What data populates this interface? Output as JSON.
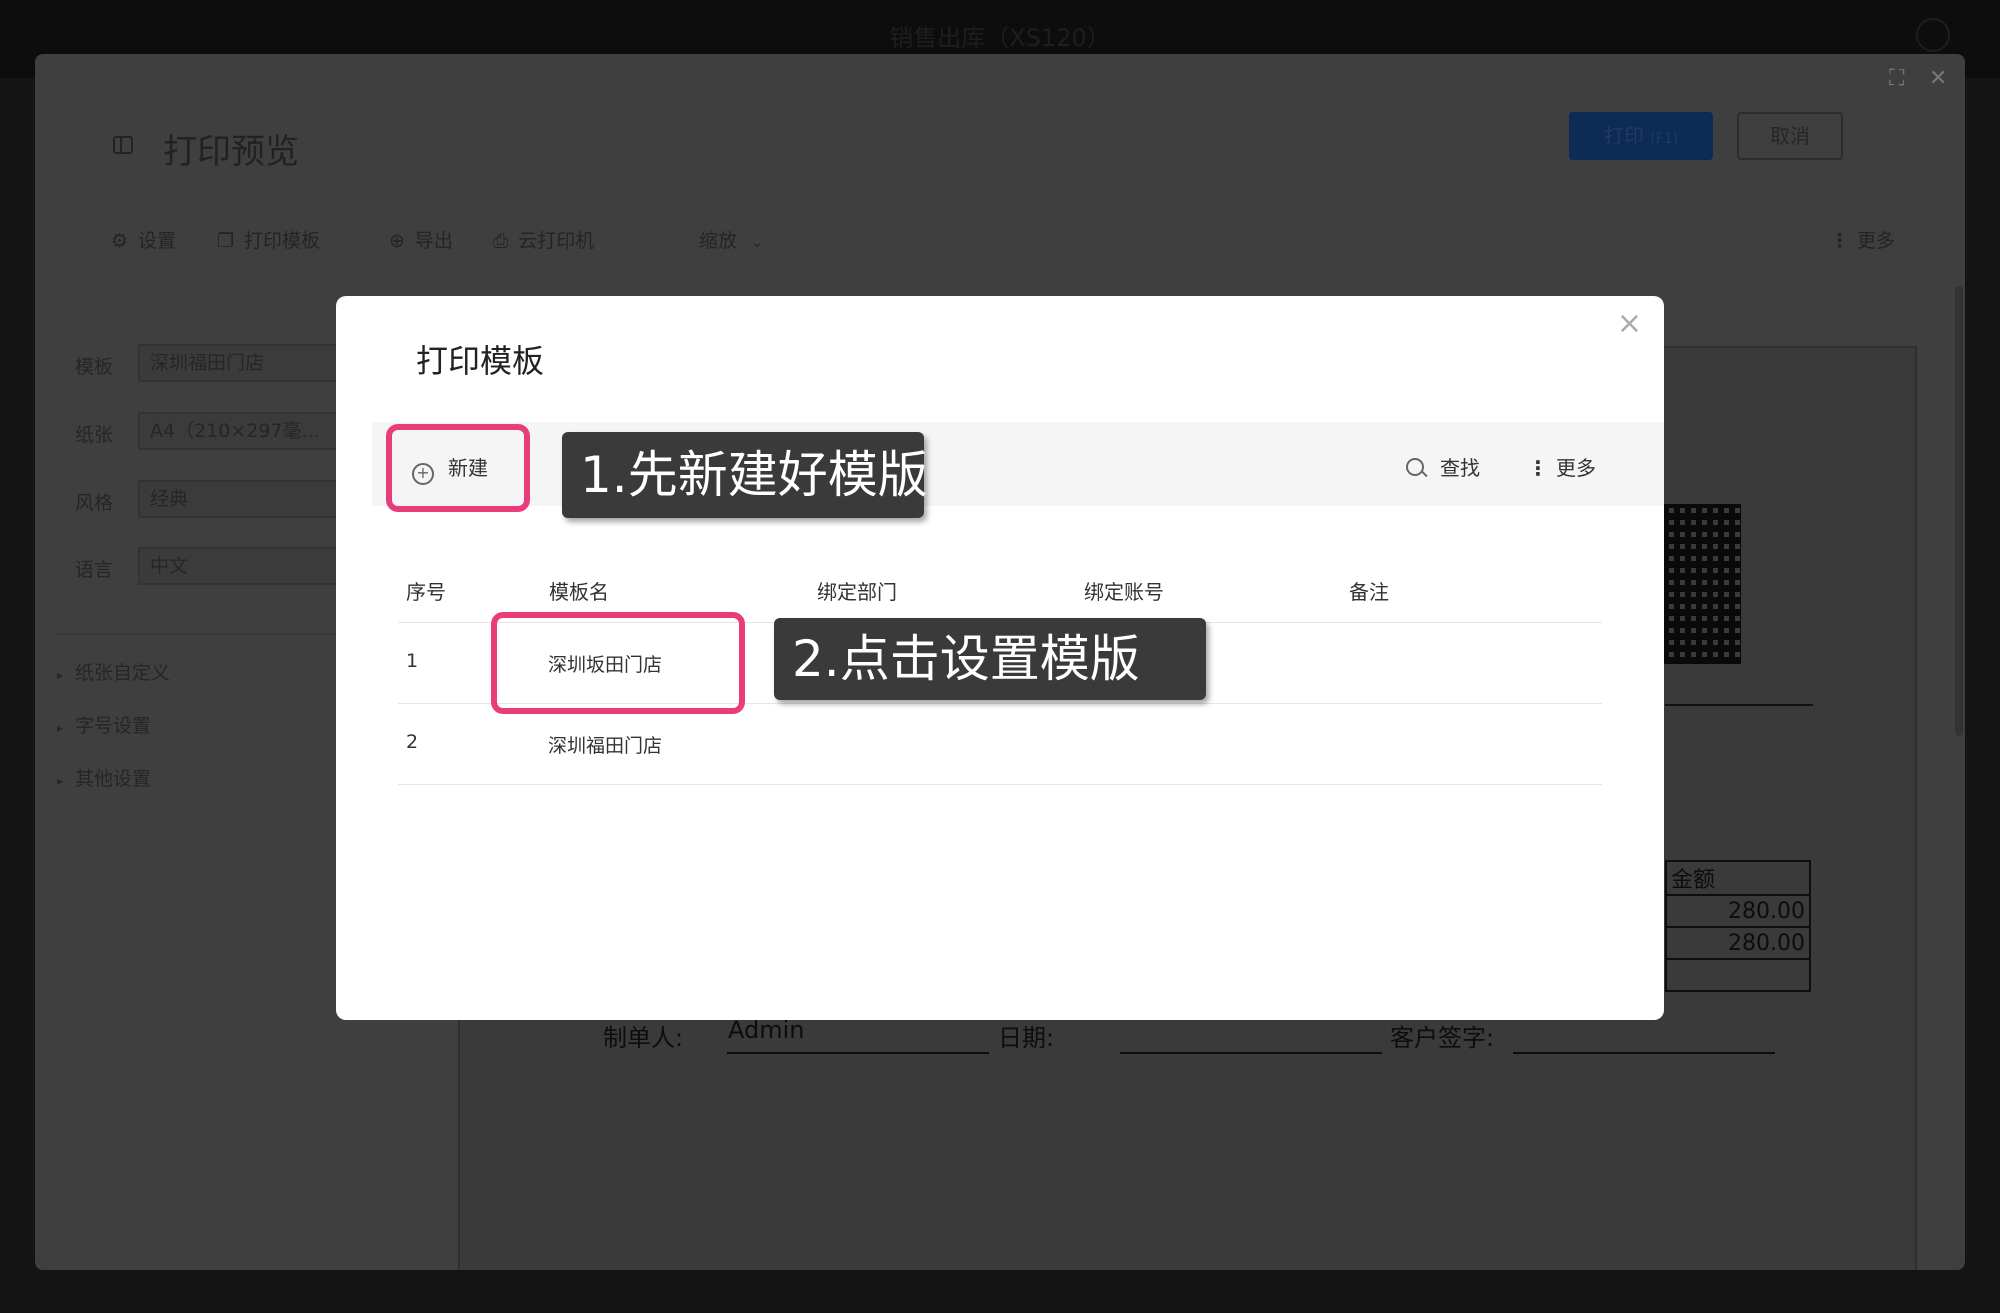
{
  "app": {
    "window_title": "销售出库（XS120）"
  },
  "header": {
    "title": "打印预览",
    "print_label": "打印",
    "print_shortcut": "(F1)",
    "cancel_label": "取消"
  },
  "toolbar": {
    "settings": "设置",
    "print_template": "打印模板",
    "export": "导出",
    "cloud_printer": "云打印机",
    "zoom": "缩放",
    "more": "更多"
  },
  "form": {
    "template_label": "模板",
    "template_value": "深圳福田门店",
    "paper_label": "纸张",
    "paper_value": "A4（210×297毫...",
    "style_label": "风格",
    "style_value": "经典",
    "lang_label": "语言",
    "lang_value": "中文"
  },
  "sections": [
    "纸张自定义",
    "字号设置",
    "其他设置"
  ],
  "preview": {
    "amount_header": "金额",
    "amounts": [
      "280.00",
      "280.00"
    ],
    "maker_label": "制单人:",
    "maker_value": "Admin",
    "date_label": "日期:",
    "signature_label": "客户签字:"
  },
  "modal": {
    "title": "打印模板",
    "new_label": "新建",
    "search_label": "查找",
    "more_label": "更多",
    "callout1": "1.先新建好模版",
    "callout2": "2.点击设置模版",
    "columns": [
      "序号",
      "模板名",
      "绑定部门",
      "绑定账号",
      "备注"
    ],
    "rows": [
      {
        "no": "1",
        "name": "深圳坂田门店"
      },
      {
        "no": "2",
        "name": "深圳福田门店"
      }
    ]
  }
}
